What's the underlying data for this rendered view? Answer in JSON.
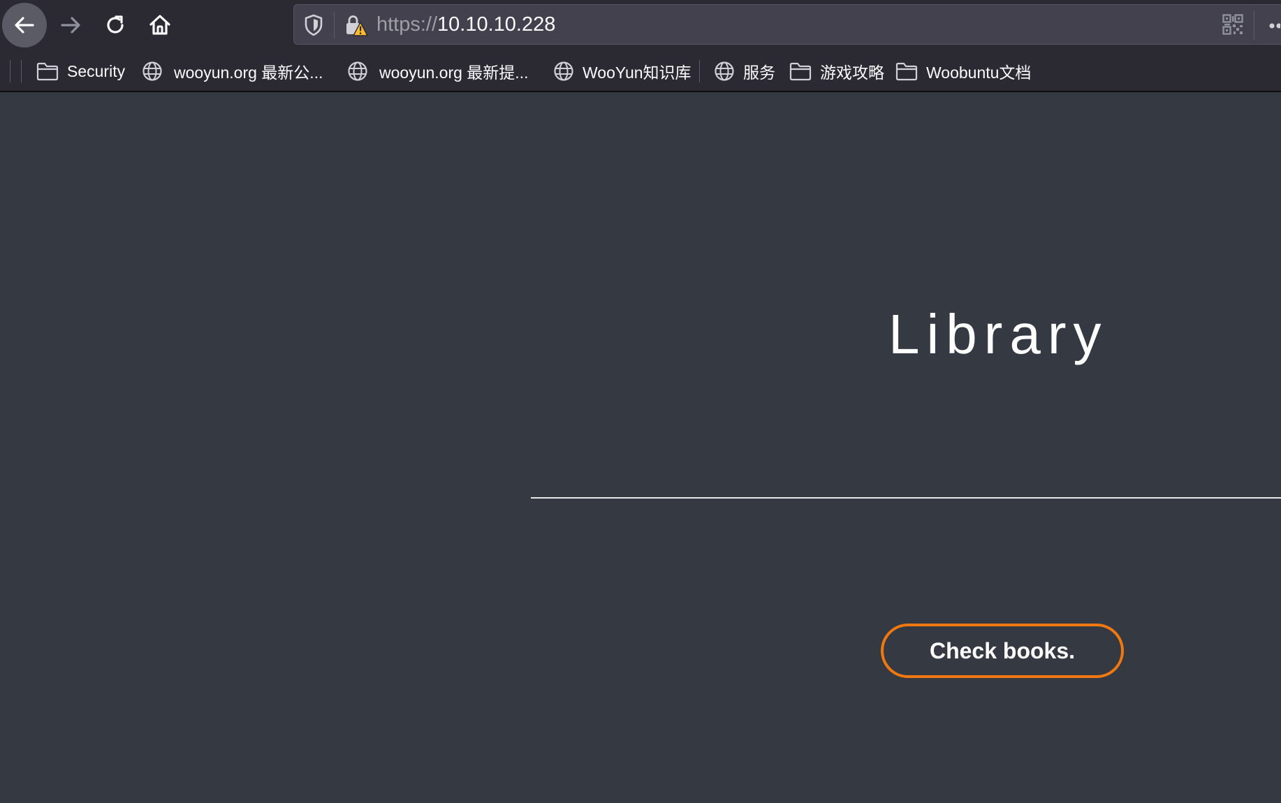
{
  "browser": {
    "url_scheme": "https://",
    "url_host": "10.10.10.228"
  },
  "bookmarks": [
    {
      "label": "Security",
      "icon": "folder-icon"
    },
    {
      "label": "wooyun.org 最新公...",
      "icon": "globe-icon"
    },
    {
      "label": "wooyun.org 最新提...",
      "icon": "globe-icon"
    },
    {
      "label": "WooYun知识库",
      "icon": "globe-icon"
    },
    {
      "label": "服务",
      "icon": "globe-icon"
    },
    {
      "label": "游戏攻略",
      "icon": "folder-icon"
    },
    {
      "label": "Woobuntu文档",
      "icon": "folder-icon"
    }
  ],
  "page": {
    "title": "Library",
    "button_label": "Check books."
  },
  "colors": {
    "toolbar_bg": "#2b2a33",
    "page_bg": "#353a42",
    "accent": "#f07810",
    "text": "#ffffff"
  }
}
